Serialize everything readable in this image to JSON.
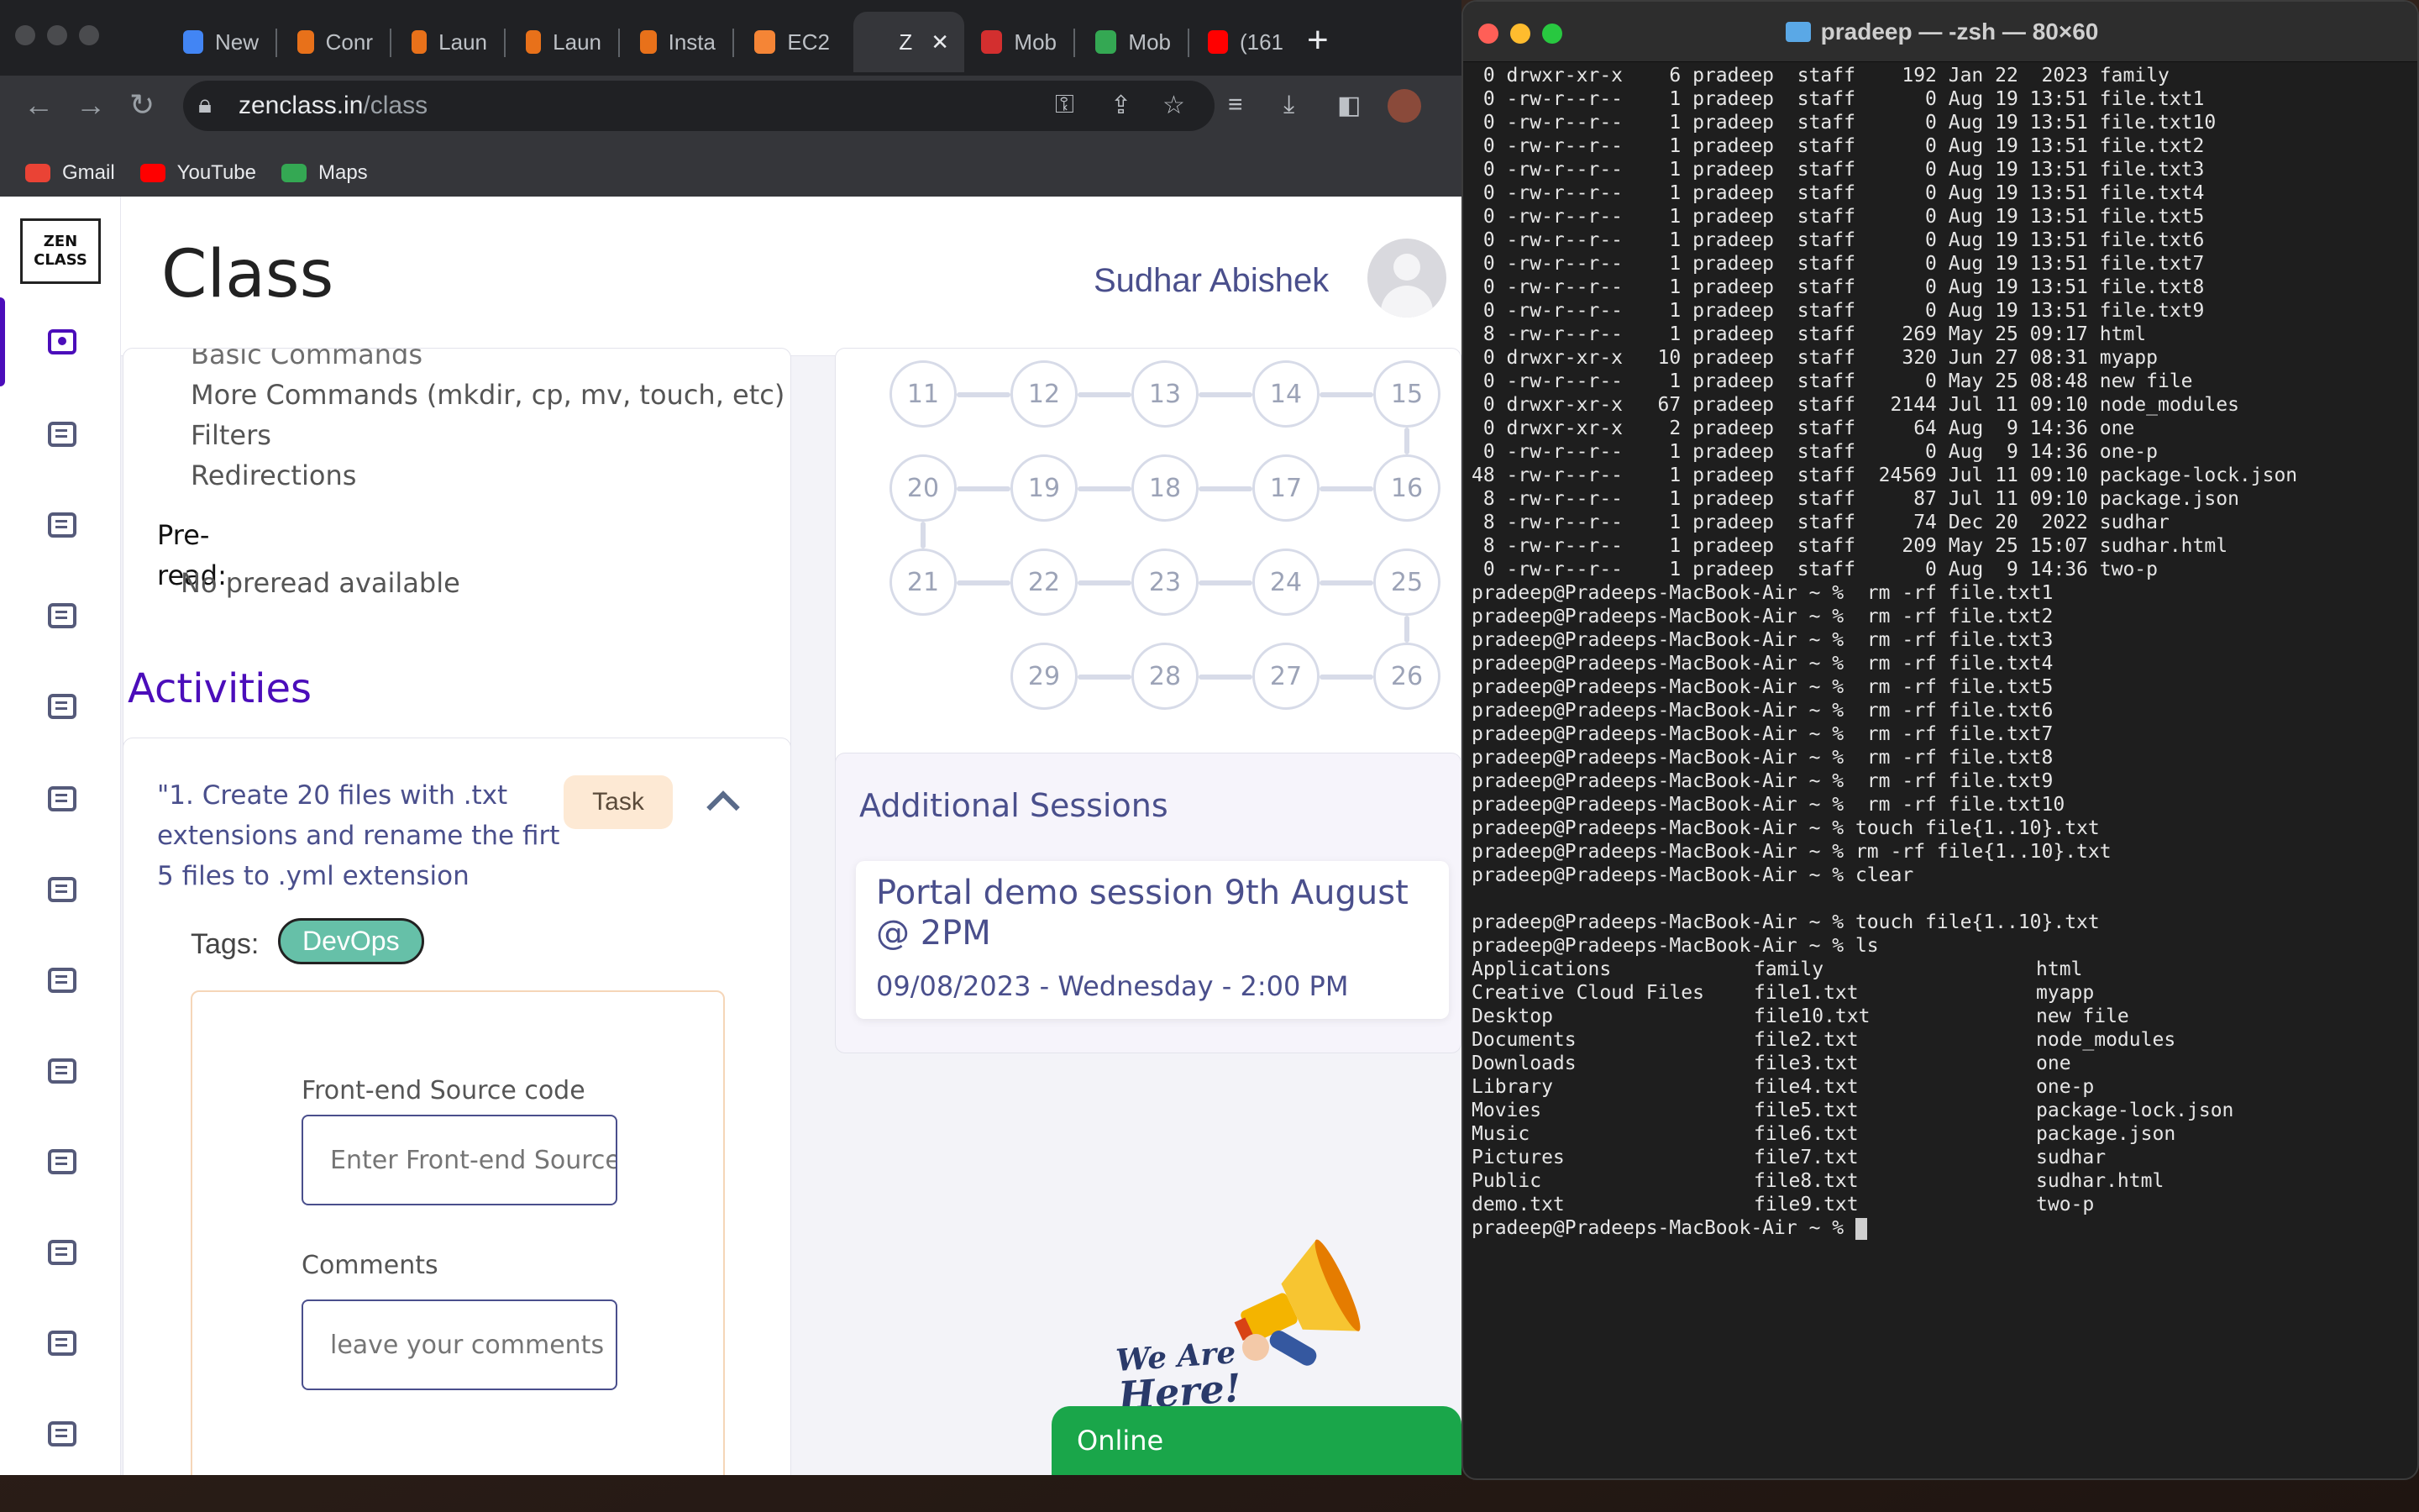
{
  "browser": {
    "tabs": [
      {
        "label": "New",
        "icon": "chrome-icon",
        "color": "#4285f4"
      },
      {
        "label": "Conr",
        "icon": "aws-icon",
        "color": "#e8711a"
      },
      {
        "label": "Laun",
        "icon": "aws-icon",
        "color": "#e8711a"
      },
      {
        "label": "Laun",
        "icon": "aws-icon",
        "color": "#e8711a"
      },
      {
        "label": "Insta",
        "icon": "aws-icon",
        "color": "#e8711a"
      },
      {
        "label": "EC2",
        "icon": "ec2-icon",
        "color": "#f58536"
      },
      {
        "label": "Z",
        "icon": "zen-icon",
        "color": "#35363a"
      },
      {
        "label": "Mob",
        "icon": "mobiscroll-icon",
        "color": "#d32f2f"
      },
      {
        "label": "Mob",
        "icon": "play-icon",
        "color": "#34a853"
      },
      {
        "label": "(161",
        "icon": "youtube-icon",
        "color": "#ff0000"
      }
    ],
    "url_host": "zenclass.in",
    "url_path": "/class",
    "bookmarks": [
      {
        "label": "Gmail",
        "icon": "gmail-icon",
        "color": "#ea4335"
      },
      {
        "label": "YouTube",
        "icon": "youtube-icon",
        "color": "#ff0000"
      },
      {
        "label": "Maps",
        "icon": "maps-icon",
        "color": "#34a853"
      }
    ]
  },
  "page": {
    "logo_line1": "ZEN",
    "logo_line2": "CLASS",
    "title": "Class",
    "user_name": "Sudhar Abishek",
    "topics": {
      "partial_line": "Basic Commands",
      "lines": [
        "More Commands (mkdir, cp, mv, touch, etc)",
        "Filters",
        "Redirections"
      ],
      "preread_label_1": "Pre-",
      "preread_label_2": "read:",
      "preread_value": "No preread available"
    },
    "activities_title": "Activities",
    "activity": {
      "title": "\"1. Create 20 files with .txt extensions and rename the firt 5 files to .yml extension",
      "badge": "Task",
      "tags_label": "Tags:",
      "tag": "DevOps",
      "frontend_label": "Front-end Source code",
      "frontend_placeholder": "Enter Front-end Source code",
      "comments_label": "Comments",
      "comments_placeholder": "leave your comments"
    },
    "roadmap": {
      "row1": [
        "11",
        "12",
        "13",
        "14",
        "15"
      ],
      "row2": [
        "20",
        "19",
        "18",
        "17",
        "16"
      ],
      "row3": [
        "21",
        "22",
        "23",
        "24",
        "25"
      ],
      "row4": [
        "29",
        "28",
        "27",
        "26"
      ]
    },
    "sessions": {
      "title": "Additional Sessions",
      "name": "Portal demo session 9th August @ 2PM",
      "date": "09/08/2023 - Wednesday - 2:00 PM"
    },
    "promo_line1": "We Are",
    "promo_line2": "Here!",
    "online_label": "Online"
  },
  "terminal": {
    "title": "pradeep — -zsh — 80×60",
    "listing": [
      " 0 drwxr-xr-x    6 pradeep  staff    192 Jan 22  2023 family",
      " 0 -rw-r--r--    1 pradeep  staff      0 Aug 19 13:51 file.txt1",
      " 0 -rw-r--r--    1 pradeep  staff      0 Aug 19 13:51 file.txt10",
      " 0 -rw-r--r--    1 pradeep  staff      0 Aug 19 13:51 file.txt2",
      " 0 -rw-r--r--    1 pradeep  staff      0 Aug 19 13:51 file.txt3",
      " 0 -rw-r--r--    1 pradeep  staff      0 Aug 19 13:51 file.txt4",
      " 0 -rw-r--r--    1 pradeep  staff      0 Aug 19 13:51 file.txt5",
      " 0 -rw-r--r--    1 pradeep  staff      0 Aug 19 13:51 file.txt6",
      " 0 -rw-r--r--    1 pradeep  staff      0 Aug 19 13:51 file.txt7",
      " 0 -rw-r--r--    1 pradeep  staff      0 Aug 19 13:51 file.txt8",
      " 0 -rw-r--r--    1 pradeep  staff      0 Aug 19 13:51 file.txt9",
      " 8 -rw-r--r--    1 pradeep  staff    269 May 25 09:17 html",
      " 0 drwxr-xr-x   10 pradeep  staff    320 Jun 27 08:31 myapp",
      " 0 -rw-r--r--    1 pradeep  staff      0 May 25 08:48 new file",
      " 0 drwxr-xr-x   67 pradeep  staff   2144 Jul 11 09:10 node_modules",
      " 0 drwxr-xr-x    2 pradeep  staff     64 Aug  9 14:36 one",
      " 0 -rw-r--r--    1 pradeep  staff      0 Aug  9 14:36 one-p",
      "48 -rw-r--r--    1 pradeep  staff  24569 Jul 11 09:10 package-lock.json",
      " 8 -rw-r--r--    1 pradeep  staff     87 Jul 11 09:10 package.json",
      " 8 -rw-r--r--    1 pradeep  staff     74 Dec 20  2022 sudhar",
      " 8 -rw-r--r--    1 pradeep  staff    209 May 25 15:07 sudhar.html",
      " 0 -rw-r--r--    1 pradeep  staff      0 Aug  9 14:36 two-p"
    ],
    "history": [
      "pradeep@Pradeeps-MacBook-Air ~ %  rm -rf file.txt1",
      "pradeep@Pradeeps-MacBook-Air ~ %  rm -rf file.txt2",
      "pradeep@Pradeeps-MacBook-Air ~ %  rm -rf file.txt3",
      "pradeep@Pradeeps-MacBook-Air ~ %  rm -rf file.txt4",
      "pradeep@Pradeeps-MacBook-Air ~ %  rm -rf file.txt5",
      "pradeep@Pradeeps-MacBook-Air ~ %  rm -rf file.txt6",
      "pradeep@Pradeeps-MacBook-Air ~ %  rm -rf file.txt7",
      "pradeep@Pradeeps-MacBook-Air ~ %  rm -rf file.txt8",
      "pradeep@Pradeeps-MacBook-Air ~ %  rm -rf file.txt9",
      "pradeep@Pradeeps-MacBook-Air ~ %  rm -rf file.txt10",
      "pradeep@Pradeeps-MacBook-Air ~ % touch file{1..10}.txt",
      "pradeep@Pradeeps-MacBook-Air ~ % rm -rf file{1..10}.txt",
      "pradeep@Pradeeps-MacBook-Air ~ % clear",
      "",
      "pradeep@Pradeeps-MacBook-Air ~ % touch file{1..10}.txt",
      "pradeep@Pradeeps-MacBook-Air ~ % ls"
    ],
    "ls_col1": [
      "Applications",
      "Creative Cloud Files",
      "Desktop",
      "Documents",
      "Downloads",
      "Library",
      "Movies",
      "Music",
      "Pictures",
      "Public",
      "demo.txt"
    ],
    "ls_col2": [
      "family",
      "file1.txt",
      "file10.txt",
      "file2.txt",
      "file3.txt",
      "file4.txt",
      "file5.txt",
      "file6.txt",
      "file7.txt",
      "file8.txt",
      "file9.txt"
    ],
    "ls_col3": [
      "html",
      "myapp",
      "new file",
      "node_modules",
      "one",
      "one-p",
      "package-lock.json",
      "package.json",
      "sudhar",
      "sudhar.html",
      "two-p"
    ],
    "prompt": "pradeep@Pradeeps-MacBook-Air ~ % "
  }
}
